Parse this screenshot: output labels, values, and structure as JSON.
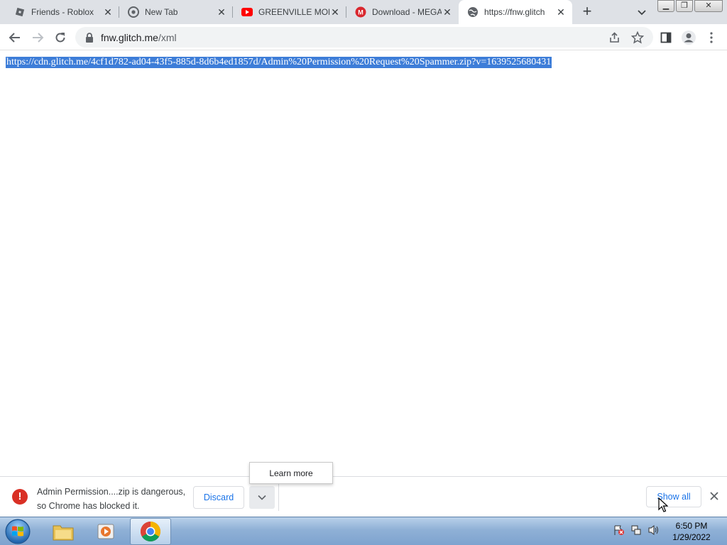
{
  "browser": {
    "tabs": [
      {
        "title": "Friends - Roblox",
        "favicon": "roblox-icon"
      },
      {
        "title": "New Tab",
        "favicon": "chrome-icon"
      },
      {
        "title": "GREENVILLE MON",
        "favicon": "youtube-icon"
      },
      {
        "title": "Download - MEGA",
        "favicon": "mega-icon"
      },
      {
        "title": "https://fnw.glitch",
        "favicon": "globe-icon",
        "active": true
      }
    ],
    "address": {
      "domain": "fnw.glitch.me",
      "path": "/xml"
    }
  },
  "content": {
    "selected_text": "https://cdn.glitch.me/4cf1d782-ad04-43f5-885d-8d6b4ed1857d/Admin%20Permission%20Request%20Spammer.zip?v=1639525680431"
  },
  "popup": {
    "label": "Learn more"
  },
  "download_bar": {
    "warning_line1": "Admin Permission....zip is dangerous,",
    "warning_line2": "so Chrome has blocked it.",
    "discard_label": "Discard",
    "show_all_label": "Show all"
  },
  "taskbar": {
    "time": "6:50 PM",
    "date": "1/29/2022"
  },
  "colors": {
    "selection": "#3d7dd8",
    "link_blue": "#1a73e8",
    "danger": "#d93025"
  }
}
